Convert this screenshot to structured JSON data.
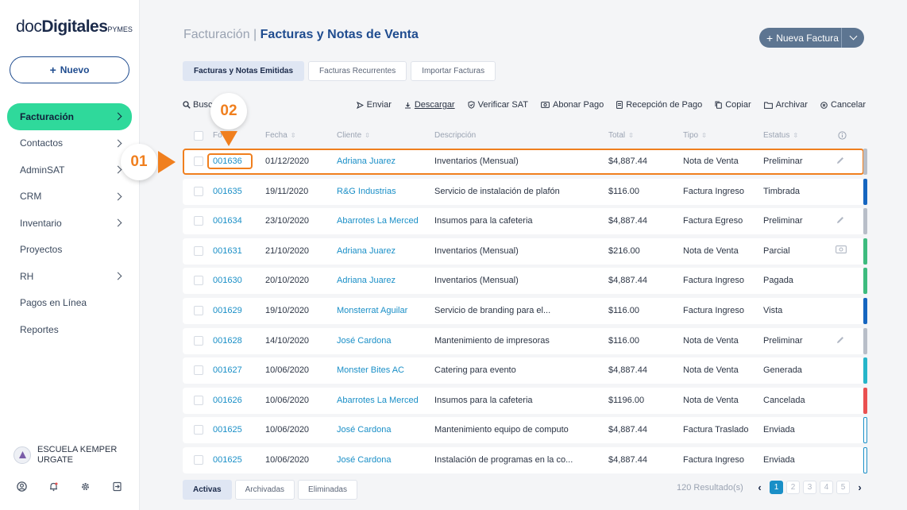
{
  "brand": {
    "part1": "doc",
    "part2": "Digitales",
    "part3": "PYMES"
  },
  "sidebar": {
    "new_button": "Nuevo",
    "items": [
      {
        "label": "Facturación",
        "chevron": true,
        "active": true
      },
      {
        "label": "Contactos",
        "chevron": true
      },
      {
        "label": "AdminSAT",
        "chevron": true
      },
      {
        "label": "CRM",
        "chevron": true
      },
      {
        "label": "Inventario",
        "chevron": true
      },
      {
        "label": "Proyectos",
        "chevron": false
      },
      {
        "label": "RH",
        "chevron": true
      },
      {
        "label": "Pagos en Línea",
        "chevron": false
      },
      {
        "label": "Reportes",
        "chevron": false
      }
    ],
    "user_name": "ESCUELA KEMPER URGATE",
    "bottom_icons": [
      "user-circle-icon",
      "bell-icon",
      "gear-icon",
      "logout-icon"
    ]
  },
  "header": {
    "crumb_parent": "Facturación |",
    "crumb_current": "Facturas y Notas de Venta",
    "new_invoice_button": "Nueva Factura"
  },
  "tabs": [
    "Facturas y Notas Emitidas",
    "Facturas Recurrentes",
    "Importar Facturas"
  ],
  "toolbar": {
    "search_label": "Busc",
    "actions": [
      {
        "label": "Enviar",
        "icon": "send-icon"
      },
      {
        "label": "Descargar",
        "icon": "download-icon",
        "underline": true
      },
      {
        "label": "Verificar SAT",
        "icon": "shield-check-icon"
      },
      {
        "label": "Abonar Pago",
        "icon": "cash-icon"
      },
      {
        "label": "Recepción de Pago",
        "icon": "document-icon"
      },
      {
        "label": "Copiar",
        "icon": "copy-icon"
      },
      {
        "label": "Archivar",
        "icon": "folder-icon"
      },
      {
        "label": "Cancelar",
        "icon": "cancel-icon"
      }
    ]
  },
  "columns": {
    "folio": "Fo",
    "fecha": "Fecha",
    "cliente": "Cliente",
    "descripcion": "Descripción",
    "total": "Total",
    "tipo": "Tipo",
    "estatus": "Estatus"
  },
  "rows": [
    {
      "folio": "001636",
      "fecha": "01/12/2020",
      "cliente": "Adriana Juarez",
      "descripcion": "Inventarios (Mensual)",
      "total": "$4,887.44",
      "tipo": "Nota de Venta",
      "estatus": "Preliminar",
      "icon": "pencil-icon",
      "status_color": "#b8bec8",
      "selected": true
    },
    {
      "folio": "001635",
      "fecha": "19/11/2020",
      "cliente": "R&G Industrias",
      "descripcion": "Servicio de instalación de plafón",
      "total": "$116.00",
      "tipo": "Factura Ingreso",
      "estatus": "Timbrada",
      "icon": "",
      "status_color": "#1565c0"
    },
    {
      "folio": "001634",
      "fecha": "23/10/2020",
      "cliente": "Abarrotes La Merced",
      "descripcion": "Insumos para la cafeteria",
      "total": "$4,887.44",
      "tipo": "Factura Egreso",
      "estatus": "Preliminar",
      "icon": "pencil-icon",
      "status_color": "#b8bec8"
    },
    {
      "folio": "001631",
      "fecha": "21/10/2020",
      "cliente": "Adriana Juarez",
      "descripcion": "Inventarios (Mensual)",
      "total": "$216.00",
      "tipo": "Nota de Venta",
      "estatus": "Parcial",
      "icon": "cash-icon",
      "status_color": "#3dbb7e"
    },
    {
      "folio": "001630",
      "fecha": "20/10/2020",
      "cliente": "Adriana Juarez",
      "descripcion": "Inventarios (Mensual)",
      "total": "$4,887.44",
      "tipo": "Factura Ingreso",
      "estatus": "Pagada",
      "icon": "",
      "status_color": "#3dbb7e"
    },
    {
      "folio": "001629",
      "fecha": "19/10/2020",
      "cliente": "Monsterrat Aguilar",
      "descripcion": "Servicio de branding para el...",
      "total": "$116.00",
      "tipo": "Factura Ingreso",
      "estatus": "Vista",
      "icon": "",
      "status_color": "#1565c0"
    },
    {
      "folio": "001628",
      "fecha": "14/10/2020",
      "cliente": "José Cardona",
      "descripcion": "Mantenimiento de impresoras",
      "total": "$116.00",
      "tipo": "Nota de Venta",
      "estatus": "Preliminar",
      "icon": "pencil-icon",
      "status_color": "#b8bec8"
    },
    {
      "folio": "001627",
      "fecha": "10/06/2020",
      "cliente": "Monster Bites AC",
      "descripcion": "Catering para evento",
      "total": "$4,887.44",
      "tipo": "Nota de Venta",
      "estatus": "Generada",
      "icon": "",
      "status_color": "#26b5c9"
    },
    {
      "folio": "001626",
      "fecha": "10/06/2020",
      "cliente": "Abarrotes La Merced",
      "descripcion": "Insumos para la cafeteria",
      "total": "$1196.00",
      "tipo": "Nota de Venta",
      "estatus": "Cancelada",
      "icon": "",
      "status_color": "#ea5050"
    },
    {
      "folio": "001625",
      "fecha": "10/06/2020",
      "cliente": "José Cardona",
      "descripcion": "Mantenimiento equipo de computo",
      "total": "$4,887.44",
      "tipo": "Factura Traslado",
      "estatus": "Enviada",
      "icon": "",
      "status_color": "#1a8fc7",
      "outline": true
    },
    {
      "folio": "001625",
      "fecha": "10/06/2020",
      "cliente": "José Cardona",
      "descripcion": "Instalación de programas en la co...",
      "total": "$4,887.44",
      "tipo": "Factura Ingreso",
      "estatus": "Enviada",
      "icon": "",
      "status_color": "#1a8fc7",
      "outline": true
    }
  ],
  "annotations": {
    "step1": "01",
    "step2": "02"
  },
  "footer": {
    "tabs": [
      "Activas",
      "Archivadas",
      "Eliminadas"
    ],
    "results": "120 Resultado(s)",
    "pages": [
      "1",
      "2",
      "3",
      "4",
      "5"
    ],
    "current_page": "1"
  },
  "colors": {
    "accent": "#2fd99b",
    "primary": "#1f4c8f",
    "link": "#1a8fc7",
    "annotation": "#f07f1e"
  }
}
